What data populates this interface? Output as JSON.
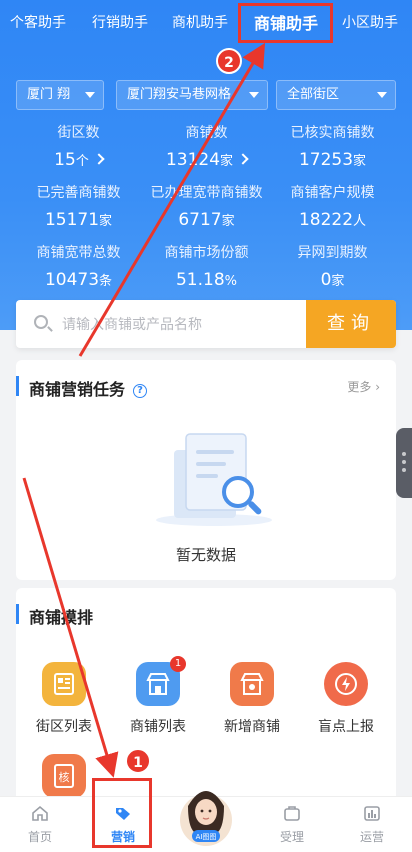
{
  "tabs": [
    {
      "label": "个客助手"
    },
    {
      "label": "行销助手"
    },
    {
      "label": "商机助手"
    },
    {
      "label": "商铺助手"
    },
    {
      "label": "小区助手"
    }
  ],
  "filters": {
    "city": "厦门 翔",
    "area": "厦门翔安马巷网格",
    "street": "全部街区"
  },
  "stats": [
    {
      "label": "街区数",
      "value": "15",
      "unit": "个"
    },
    {
      "label": "商铺数",
      "value": "13124",
      "unit": "家"
    },
    {
      "label": "已核实商铺数",
      "value": "17253",
      "unit": "家"
    },
    {
      "label": "已完善商铺数",
      "value": "15171",
      "unit": "家"
    },
    {
      "label": "已办理宽带商铺数",
      "value": "6717",
      "unit": "家"
    },
    {
      "label": "商铺客户规模",
      "value": "18222",
      "unit": "人"
    },
    {
      "label": "商铺宽带总数",
      "value": "10473",
      "unit": "条"
    },
    {
      "label": "商铺市场份额",
      "value": "51.18",
      "unit": "%"
    },
    {
      "label": "异网到期数",
      "value": "0",
      "unit": "家"
    }
  ],
  "search": {
    "placeholder": "请输入商铺或产品名称",
    "button": "查询"
  },
  "task_card": {
    "title": "商铺营销任务",
    "help": "?",
    "more": "更多",
    "empty": "暂无数据"
  },
  "visit_card": {
    "title": "商铺摸排",
    "items": [
      {
        "label": "街区列表",
        "color": "#f3b43d"
      },
      {
        "label": "商铺列表",
        "color": "#4f9bf0",
        "badge": "1"
      },
      {
        "label": "新增商铺",
        "color": "#f07a4a"
      },
      {
        "label": "盲点上报",
        "color": "#f06a4a"
      }
    ],
    "extra_icon_text": "核"
  },
  "bottom_nav": [
    {
      "label": "首页"
    },
    {
      "label": "营销"
    },
    {
      "label": "AI图图"
    },
    {
      "label": "受理"
    },
    {
      "label": "运营"
    }
  ],
  "annotations": {
    "step1": "1",
    "step2": "2"
  },
  "colors": {
    "primary": "#2f86f5",
    "search_button": "#f5a623",
    "annotation_red": "#e8372c"
  }
}
